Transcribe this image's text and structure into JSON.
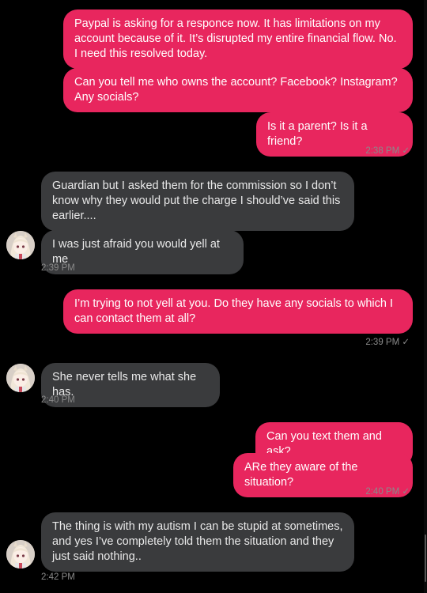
{
  "conversation": {
    "messages": [
      {
        "side": "out",
        "text": "Paypal is asking for a responce now.  It has limitations on my account because of it. It’s disrupted my entire financial flow.  No. I need this resolved today."
      },
      {
        "side": "out",
        "text": "Can you tell me who owns the account?  Facebook? Instagram? Any socials?"
      },
      {
        "side": "out",
        "text": "Is it a parent?  Is it a friend?"
      },
      {
        "side": "in",
        "text": "Guardian but I asked them for the commission so I don’t know why they would put the charge I should’ve said this earlier...."
      },
      {
        "side": "in",
        "text": "I was just afraid you would yell at me"
      },
      {
        "side": "out",
        "text": "I’m trying to not yell at you.  Do they have any socials to which I can contact them at all?"
      },
      {
        "side": "in",
        "text": "She never tells me what she has."
      },
      {
        "side": "out",
        "text": "Can you text them and ask?"
      },
      {
        "side": "out",
        "text": "ARe they aware of the situation?"
      },
      {
        "side": "in",
        "text": "The thing is with my autism I can be stupid at sometimes, and yes I’ve completely told them the situation and they just said nothing.."
      }
    ],
    "timestamps": [
      "2:38 PM ✓",
      "2:39 PM",
      "2:39 PM ✓",
      "2:40 PM",
      "2:40 PM ✓",
      "2:42 PM"
    ]
  },
  "colors": {
    "outgoing_bubble": "#e8265e",
    "incoming_bubble": "#3a3b3d",
    "background": "#000000",
    "timestamp": "#8a8a8a"
  },
  "icons": {
    "avatar": "anime-girl-avatar",
    "read_receipt": "checkmark-icon"
  }
}
